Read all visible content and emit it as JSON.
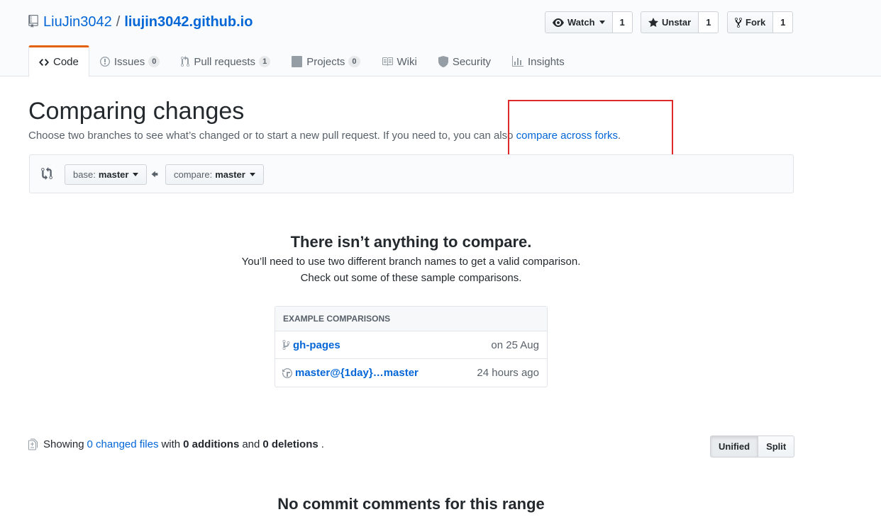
{
  "repo": {
    "owner": "LiuJin3042",
    "separator": "/",
    "name": "liujin3042.github.io"
  },
  "actions": {
    "watch": {
      "label": "Watch",
      "count": "1"
    },
    "star": {
      "label": "Unstar",
      "count": "1"
    },
    "fork": {
      "label": "Fork",
      "count": "1"
    }
  },
  "nav": {
    "code": "Code",
    "issues": {
      "label": "Issues",
      "count": "0"
    },
    "pulls": {
      "label": "Pull requests",
      "count": "1"
    },
    "projects": {
      "label": "Projects",
      "count": "0"
    },
    "wiki": "Wiki",
    "security": "Security",
    "insights": "Insights"
  },
  "compare": {
    "title": "Comparing changes",
    "description": "Choose two branches to see what’s changed or to start a new pull request. If you need to, you can also ",
    "forks_link": "compare across forks",
    "period": ".",
    "base_prefix": "base:",
    "base_branch": "master",
    "compare_prefix": "compare:",
    "compare_branch": "master"
  },
  "blankslate": {
    "title": "There isn’t anything to compare.",
    "line1": "You’ll need to use two different branch names to get a valid comparison.",
    "line2": "Check out some of these sample comparisons."
  },
  "examples": {
    "header": "EXAMPLE COMPARISONS",
    "rows": [
      {
        "name": "gh-pages",
        "time": "on 25 Aug"
      },
      {
        "name": "master@{1day}…master",
        "time": "24 hours ago"
      }
    ]
  },
  "toc": {
    "showing": "Showing",
    "changed_files": "0 changed files",
    "with": "with",
    "additions": "0 additions",
    "and": "and",
    "deletions": "0 deletions",
    "period": "."
  },
  "diff_view": {
    "unified": "Unified",
    "split": "Split"
  },
  "footer": {
    "no_comments": "No commit comments for this range"
  },
  "colors": {
    "link": "#0366d6",
    "accent_tab": "#e36209",
    "highlight": "#e02a2a"
  }
}
